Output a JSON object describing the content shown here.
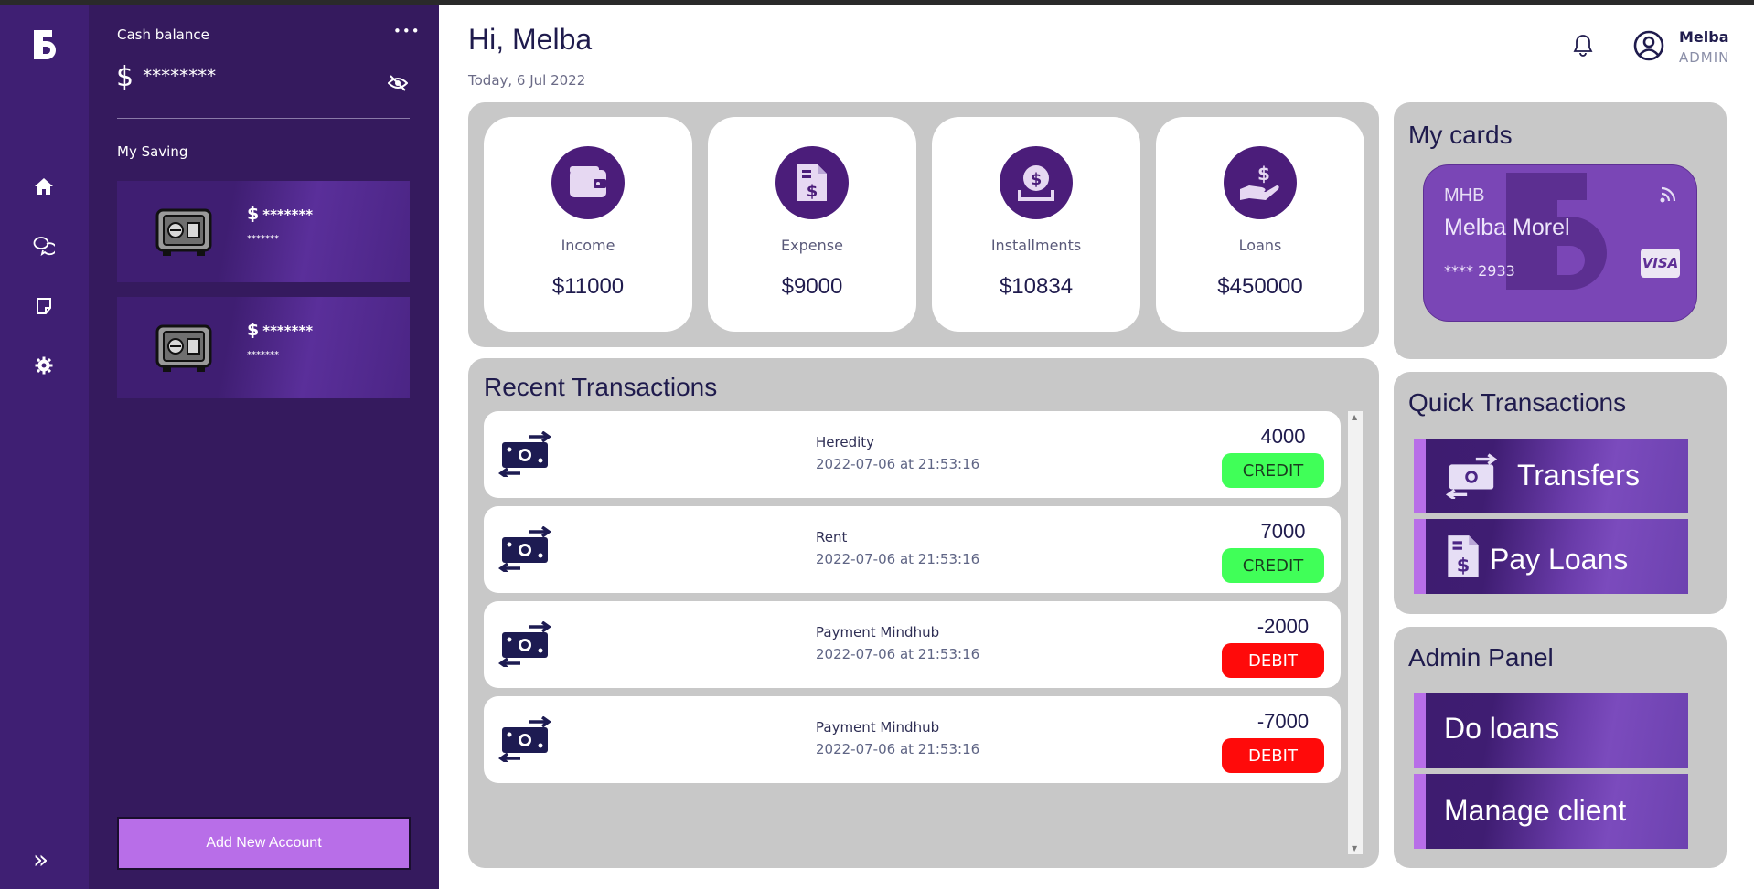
{
  "app": {
    "logo_letter": "B"
  },
  "rail": {
    "items": [
      "home-icon",
      "chat-icon",
      "notes-icon",
      "gear-icon",
      "expand-icon"
    ],
    "expand_glyph": "»"
  },
  "wallet": {
    "cash_label": "Cash balance",
    "menu_glyph": "•••",
    "currency_symbol": "$",
    "cash_value": "********",
    "savings_label": "My Saving",
    "savings": [
      {
        "currency": "$",
        "amount": "*******",
        "number": "*******"
      },
      {
        "currency": "$",
        "amount": "*******",
        "number": "*******"
      }
    ],
    "add_button": "Add New Account"
  },
  "header": {
    "greeting": "Hi, Melba",
    "date": "Today, 6 Jul 2022",
    "user_name": "Melba",
    "user_role": "ADMIN"
  },
  "stats": [
    {
      "label": "Income",
      "value": "$11000",
      "icon": "wallet-icon"
    },
    {
      "label": "Expense",
      "value": "$9000",
      "icon": "invoice-icon"
    },
    {
      "label": "Installments",
      "value": "$10834",
      "icon": "coin-deposit-icon"
    },
    {
      "label": "Loans",
      "value": "$450000",
      "icon": "hand-dollar-icon"
    }
  ],
  "transactions": {
    "title": "Recent Transactions",
    "items": [
      {
        "description": "Heredity",
        "datetime": "2022-07-06 at 21:53:16",
        "amount": "4000",
        "type": "CREDIT"
      },
      {
        "description": "Rent",
        "datetime": "2022-07-06 at 21:53:16",
        "amount": "7000",
        "type": "CREDIT"
      },
      {
        "description": "Payment Mindhub",
        "datetime": "2022-07-06 at 21:53:16",
        "amount": "-2000",
        "type": "DEBIT"
      },
      {
        "description": "Payment Mindhub",
        "datetime": "2022-07-06 at 21:53:16",
        "amount": "-7000",
        "type": "DEBIT"
      }
    ]
  },
  "cards": {
    "title": "My cards",
    "card": {
      "issuer": "MHB",
      "holder": "Melba Morel",
      "number": "**** 2933",
      "network": "VISA"
    }
  },
  "quick": {
    "title": "Quick Transactions",
    "transfers": "Transfers",
    "pay_loans": "Pay Loans"
  },
  "admin": {
    "title": "Admin Panel",
    "do_loans": "Do loans",
    "manage_client": "Manage client"
  },
  "colors": {
    "brand": "#3f1f73",
    "panel": "#351a5e",
    "accent": "#b86ee8",
    "credit": "#40ff58",
    "debit": "#ff0a0a",
    "surface": "#c8c8c8"
  }
}
